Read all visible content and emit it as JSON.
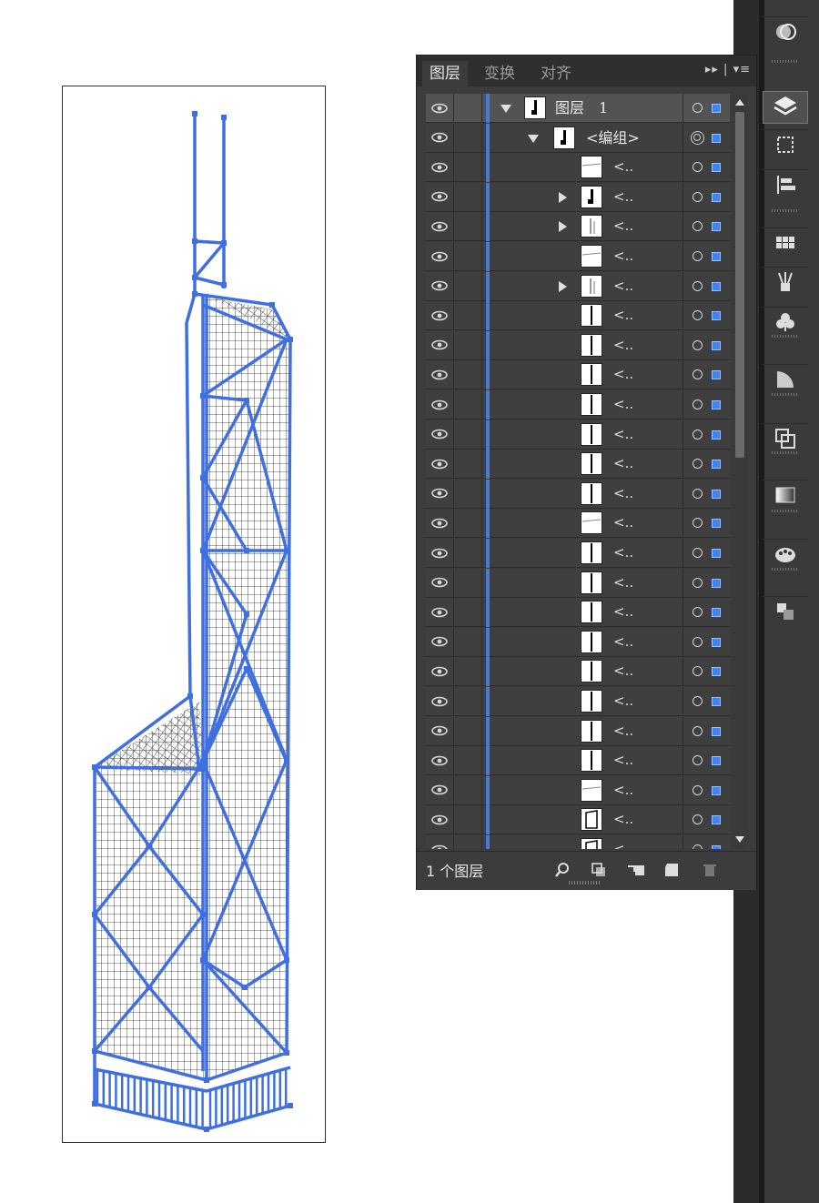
{
  "panel": {
    "tabs": [
      {
        "label": "图层",
        "active": true
      },
      {
        "label": "变换",
        "active": false
      },
      {
        "label": "对齐",
        "active": false
      }
    ],
    "menu_glyph": "▸▸ | ▾≡",
    "layer_name": "图层",
    "layer_index": "1",
    "group_label": "<编组>",
    "item_label": "<..",
    "footer_count": "1 个图层"
  },
  "colors": {
    "accent": "#4a7ad8",
    "selection": "#3d84f5",
    "panel_bg": "#3c3c3c",
    "artwork_stroke": "#3f6fe0"
  },
  "rows": [
    {
      "kind": "layer",
      "expanded": true,
      "thumb": "tower-dark"
    },
    {
      "kind": "group",
      "expanded": true,
      "thumb": "tower-dark"
    },
    {
      "kind": "item",
      "thumb": "line"
    },
    {
      "kind": "item",
      "expand": true,
      "thumb": "tower-dark"
    },
    {
      "kind": "item",
      "expand": true,
      "thumb": "tower-light"
    },
    {
      "kind": "item",
      "thumb": "line"
    },
    {
      "kind": "item",
      "expand": true,
      "thumb": "tower-light"
    },
    {
      "kind": "item",
      "thumb": "bar"
    },
    {
      "kind": "item",
      "thumb": "bar"
    },
    {
      "kind": "item",
      "thumb": "bar"
    },
    {
      "kind": "item",
      "thumb": "bar"
    },
    {
      "kind": "item",
      "thumb": "bar"
    },
    {
      "kind": "item",
      "thumb": "bar"
    },
    {
      "kind": "item",
      "thumb": "bar"
    },
    {
      "kind": "item",
      "thumb": "line"
    },
    {
      "kind": "item",
      "thumb": "bar"
    },
    {
      "kind": "item",
      "thumb": "bar"
    },
    {
      "kind": "item",
      "thumb": "bar"
    },
    {
      "kind": "item",
      "thumb": "bar"
    },
    {
      "kind": "item",
      "thumb": "bar"
    },
    {
      "kind": "item",
      "thumb": "bar"
    },
    {
      "kind": "item",
      "thumb": "bar"
    },
    {
      "kind": "item",
      "thumb": "bar"
    },
    {
      "kind": "item",
      "thumb": "line"
    },
    {
      "kind": "item",
      "thumb": "frame"
    },
    {
      "kind": "item",
      "thumb": "frame"
    }
  ],
  "footer_icons": [
    "search-icon",
    "clipping-mask-icon",
    "sublayer-icon",
    "new-layer-icon",
    "trash-icon"
  ],
  "dock_icons": [
    "transparency-icon",
    "layers-icon",
    "transform-icon",
    "align-icon",
    "swatches-icon",
    "brushes-icon",
    "symbols-icon",
    "color-guide-icon",
    "pathfinder-icon",
    "gradient-icon",
    "color-icon",
    "arrange-icon"
  ]
}
